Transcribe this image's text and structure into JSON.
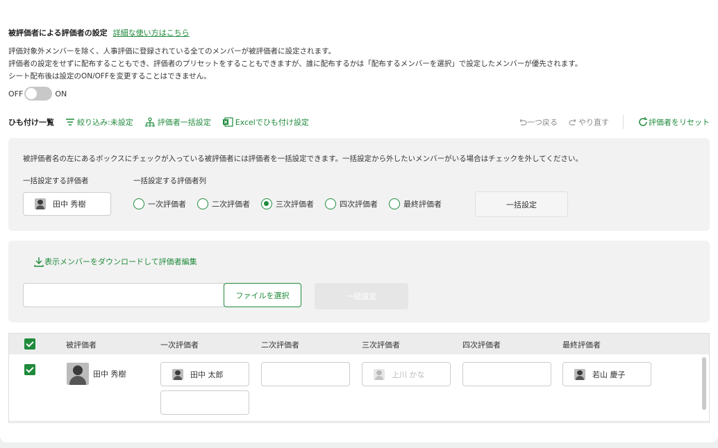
{
  "header": {
    "title": "被評価者による評価者の設定",
    "help_link": "詳細な使い方はこちら",
    "desc": [
      "評価対象外メンバーを除く、人事評価に登録されている全てのメンバーが被評価者に設定されます。",
      "評価者の設定をせずに配布することもでき、評価者のプリセットをすることもできますが、誰に配布するかは「配布するメンバーを選択」で設定したメンバーが優先されます。",
      "シート配布後は設定のON/OFFを変更することはできません。"
    ],
    "toggle_off": "OFF",
    "toggle_on": "ON"
  },
  "toolbar": {
    "title": "ひも付け一覧",
    "filter": "絞り込み:未設定",
    "bulk_set": "評価者一括設定",
    "excel": "Excelでひも付け設定",
    "undo": "一つ戻る",
    "redo": "やり直す",
    "reset": "評価者をリセット"
  },
  "bulk_panel": {
    "note": "被評価者名の左にあるボックスにチェックが入っている被評価者には評価者を一括設定できます。一括設定から外したいメンバーがいる場合はチェックを外してください。",
    "evaluator_label": "一括設定する評価者",
    "column_label": "一括設定する評価者列",
    "evaluator_name": "田中 秀樹",
    "options": [
      "一次評価者",
      "二次評価者",
      "三次評価者",
      "四次評価者",
      "最終評価者"
    ],
    "selected": "三次評価者",
    "apply": "一括設定"
  },
  "download_panel": {
    "download_link": "表示メンバーをダウンロードして評価者編集",
    "choose_file": "ファイルを選択",
    "apply": "一括設定"
  },
  "table": {
    "headers": [
      "被評価者",
      "一次評価者",
      "二次評価者",
      "三次評価者",
      "四次評価者",
      "最終評価者"
    ],
    "rows": [
      {
        "evaluatee": "田中 秀樹",
        "first": "田中 太郎",
        "second": "",
        "third": "上川 かな",
        "fourth": "",
        "final": "若山 慶子"
      }
    ]
  },
  "colors": {
    "accent": "#1f8a3b",
    "panel": "#f2f2f2"
  }
}
